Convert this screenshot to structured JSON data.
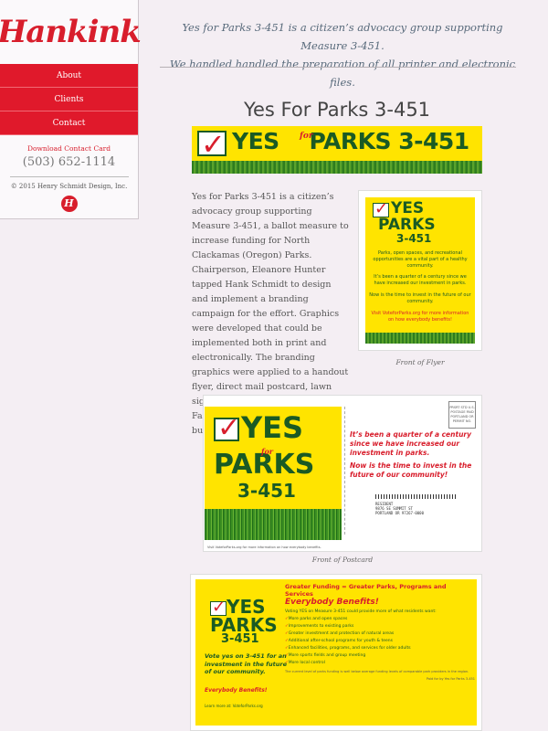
{
  "sidebar": {
    "logo_main": "Hank",
    "logo_accent": "ink",
    "nav": [
      {
        "label": "About"
      },
      {
        "label": "Clients"
      },
      {
        "label": "Contact"
      }
    ],
    "download_label": "Download Contact Card",
    "phone": "(503) 652-1114",
    "copyright": "© 2015 Henry Schmidt Design, Inc.",
    "badge": "H"
  },
  "header": {
    "intro_line1": "Yes for Parks 3-451 is a citizen’s advocacy group supporting Measure 3-451.",
    "intro_line2": "We handled handled the preparation of all printer and electronic files."
  },
  "main": {
    "title": "Yes For Parks 3-451",
    "banner": {
      "yes": "YES",
      "for": "for",
      "parks": "PARKS 3-451"
    },
    "body": "Yes for Parks 3-451 is a citizen’s advocacy group supporting Measure 3-451, a ballot measure to increase funding for North Clackamas (Oregon) Parks. Chairperson, Eleanore Hunter tapped Hank Schmidt to design and implement a branding campaign for the effort. Graphics were developed that could be implemented both in print and electronically. The branding graphics were applied to a handout flyer, direct mail postcard, lawn sign, electronic billboard, website, Facebook page and campaign button.",
    "flyer": {
      "yes": "YES",
      "parks": "PARKS",
      "num": "3-451",
      "line1": "Parks, open spaces, and recreational opportunities are a vital part of a healthy community.",
      "line2": "It’s been a quarter of a century since we have increased our investment in parks.",
      "line3": "Now is the time to invest in the future of our community.",
      "line4": "Visit VoteforParks.org for more information on how everybody benefits!",
      "caption": "Front of Flyer"
    },
    "postcard": {
      "yes": "YES",
      "for": "for",
      "parks": "PARKS",
      "num": "3-451",
      "msg1": "It’s been a quarter of a century since we have increased our investment in parks.",
      "msg2": "Now is the time to invest in the future of our community!",
      "stamp": "PRSRT STD U.S. POSTAGE PAID PORTLAND OR PERMIT NO.",
      "address": "RESIDENT\n9876 SE SUMMIT ST\nPORTLAND OR 97267-0000",
      "footer": "Visit VoteforParks.org for more information on how everybody benefits.",
      "caption": "Front of Postcard"
    },
    "hanger": {
      "yes": "YES",
      "parks": "PARKS",
      "num": "3-451",
      "vote": "Vote yes on 3-451 for an investment in the future of our community.",
      "benefit": "Everybody Benefits!",
      "learn": "Learn more at: VoteforParks.org",
      "head": "Greater Funding = Greater Parks, Programs and Services",
      "sub": "Everybody Benefits!",
      "intro": "Voting YES on Measure 3-451 could provide more of what residents want:",
      "items": [
        {
          "text": "More parks and open spaces"
        },
        {
          "text": "Improvements to existing parks"
        },
        {
          "text": "Greater investment and protection of natural areas"
        },
        {
          "text": "Additional after-school programs for youth & teens"
        },
        {
          "text": "Enhanced facilities, programs, and services for older adults"
        },
        {
          "text": "More sports fields and group meeting"
        },
        {
          "text": "More local control"
        }
      ],
      "small": "The current level of parks funding is well below average funding levels of comparable park providers in the region.",
      "credit": "Paid for by Yes for Parks 3-451"
    }
  },
  "colors": {
    "brand_red": "#e0192b",
    "park_green": "#1a5a24",
    "park_yellow": "#ffe400",
    "background": "#f4eef3"
  }
}
